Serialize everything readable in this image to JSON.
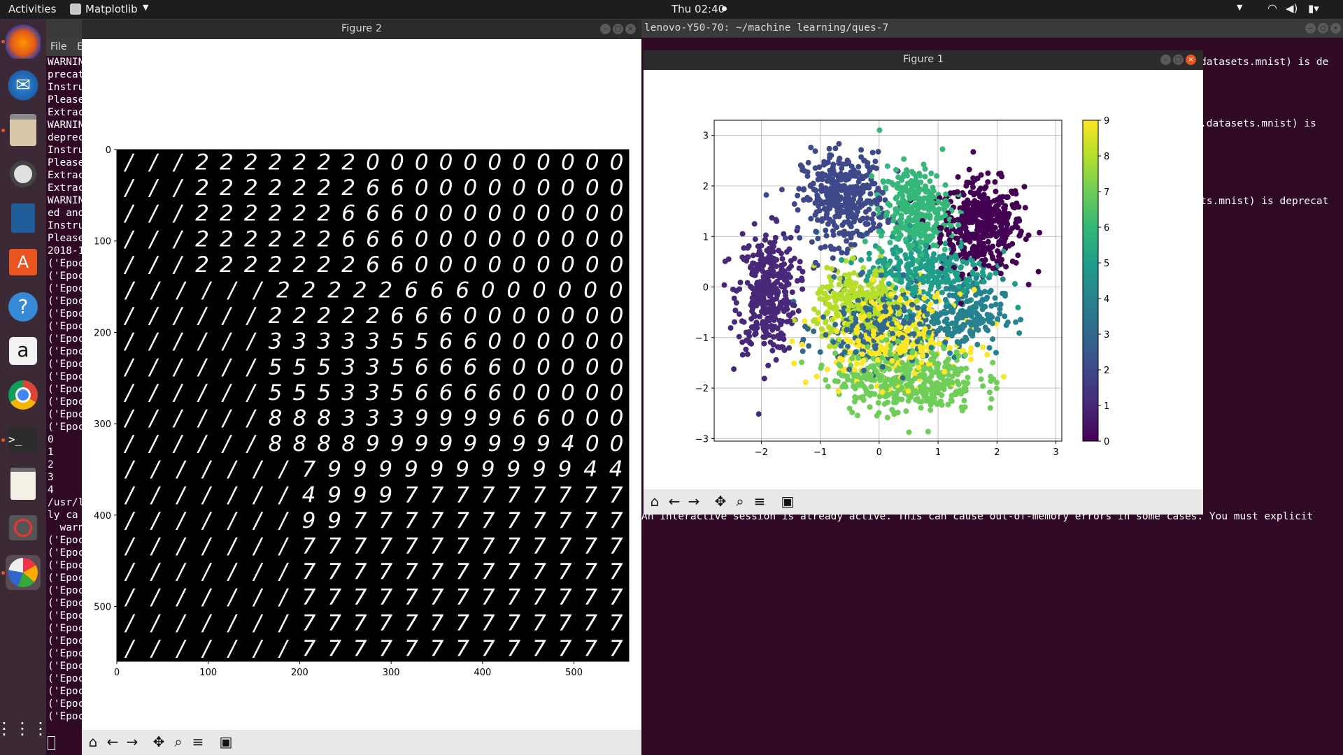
{
  "topbar": {
    "activities": "Activities",
    "app_menu": "Matplotlib",
    "clock": "Thu 02:40"
  },
  "terminal": {
    "title": "lenovo-Y50-70: ~/machine learning/ques-7",
    "menu_file": "File",
    "menu_edit": "E",
    "left_lines": [
      "WARNIN",
      "precat",
      "Instru",
      "Please",
      "Extrac",
      "WARNIN",
      "deprec",
      "Instru",
      "Please",
      "Extrac",
      "Extrac",
      "WARNIN",
      "ed and",
      "Instru",
      "Please",
      "2018-1",
      "('Epoc",
      "('Epoc",
      "('Epoc",
      "('Epoc",
      "('Epoc",
      "('Epoc",
      "('Epoc",
      "('Epoc",
      "('Epoc",
      "('Epoc",
      "('Epoc",
      "('Epoc",
      "('Epoc",
      "('Epoc",
      "0",
      "1",
      "2",
      "3",
      "4",
      "/usr/l",
      "ly ca",
      "  warn",
      "('Epoc",
      "('Epoc",
      "('Epoc",
      "('Epoc",
      "('Epoc",
      "('Epoc",
      "('Epoc",
      "('Epoc",
      "('Epoc",
      "('Epoc",
      "('Epoc",
      "('Epoc",
      "('Epoc",
      "('Epoc",
      "('Epoc"
    ],
    "right_line1": "datasets.mnist) is de",
    "right_line2": ".datasets.mnist) is",
    "right_line3": "ts.mnist) is deprecat",
    "bottom_line": "An interactive session is already active. This can cause out-of-memory errors in some cases. You must explicit"
  },
  "figure2": {
    "title": "Figure 2",
    "y_ticks": [
      "0",
      "100",
      "200",
      "300",
      "400",
      "500"
    ],
    "x_ticks": [
      "0",
      "100",
      "200",
      "300",
      "400",
      "500"
    ],
    "digit_rows": [
      "///222222200000000000",
      "///222222266000000000",
      "///222222666000000000",
      "///222222666000000000",
      "///222222266000000000",
      "//////22222666000000",
      "//////222226660000000",
      "//////333335566000000",
      "//////555335666600000",
      "//////555335666600000",
      "//////888333999966000",
      "//////888899999999400",
      "///////7999999999944",
      "///////4999777777777",
      "///////9977777777777",
      "///////7777777777777",
      "///////7777777777777",
      "///////7777777777777",
      "///////7777777777777",
      "///////7777777777777"
    ]
  },
  "figure1": {
    "title": "Figure 1",
    "chart_data": {
      "type": "scatter",
      "title": "",
      "xlabel": "",
      "ylabel": "",
      "xlim": [
        -2.8,
        3.1
      ],
      "ylim": [
        -3.05,
        3.3
      ],
      "x_ticks": [
        "−2",
        "−1",
        "0",
        "1",
        "2",
        "3"
      ],
      "y_ticks": [
        "−3",
        "−2",
        "−1",
        "0",
        "1",
        "2",
        "3"
      ],
      "grid": true,
      "colorbar": {
        "min": 0,
        "max": 9,
        "ticks": [
          "0",
          "1",
          "2",
          "3",
          "4",
          "5",
          "6",
          "7",
          "8",
          "9"
        ],
        "colormap": "viridis"
      },
      "clusters": [
        {
          "label": 0,
          "cx": 1.75,
          "cy": 1.2,
          "sx": 0.35,
          "sy": 0.45,
          "n": 420
        },
        {
          "label": 1,
          "cx": -1.9,
          "cy": -0.1,
          "sx": 0.25,
          "sy": 0.6,
          "n": 380
        },
        {
          "label": 2,
          "cx": -0.6,
          "cy": 1.75,
          "sx": 0.35,
          "sy": 0.45,
          "n": 380
        },
        {
          "label": 3,
          "cx": -0.1,
          "cy": -0.8,
          "sx": 0.45,
          "sy": 0.4,
          "n": 260
        },
        {
          "label": 4,
          "cx": 1.4,
          "cy": -0.55,
          "sx": 0.35,
          "sy": 0.35,
          "n": 220
        },
        {
          "label": 5,
          "cx": 0.8,
          "cy": 0.35,
          "sx": 0.55,
          "sy": 0.35,
          "n": 260
        },
        {
          "label": 6,
          "cx": 0.6,
          "cy": 1.5,
          "sx": 0.3,
          "sy": 0.45,
          "n": 320
        },
        {
          "label": 7,
          "cx": 0.45,
          "cy": -1.8,
          "sx": 0.6,
          "sy": 0.35,
          "n": 420
        },
        {
          "label": 8,
          "cx": -0.3,
          "cy": -0.35,
          "sx": 0.4,
          "sy": 0.35,
          "n": 260
        },
        {
          "label": 9,
          "cx": 0.2,
          "cy": -1.0,
          "sx": 0.6,
          "sy": 0.45,
          "n": 300
        }
      ]
    }
  },
  "colors": {
    "terminal_bg": "#300a24",
    "dock_bg": "#3b2a36",
    "accent": "#e95420"
  }
}
